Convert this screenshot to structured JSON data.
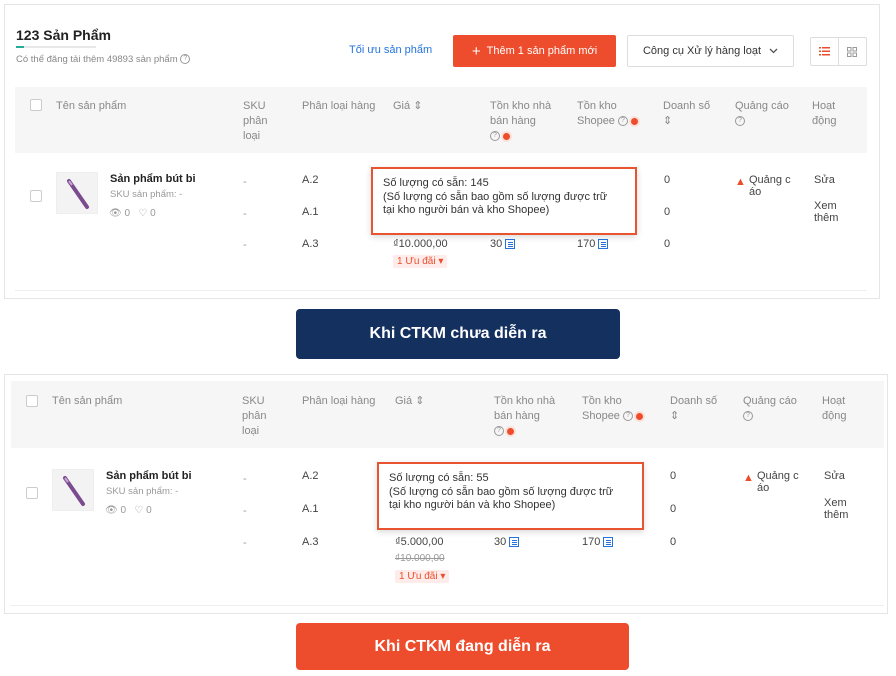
{
  "top": {
    "title": "123 Sản Phẩm",
    "subtitle": "Có thể đăng tải thêm 49893 sản phẩm",
    "optimize_link": "Tối ưu sản phẩm",
    "add_button": "Thêm 1 sản phẩm mới",
    "bulk_button": "Công cụ Xử lý hàng loạt"
  },
  "columns": {
    "name": "Tên sản phẩm",
    "sku_l1": "SKU",
    "sku_l2": "phân",
    "sku_l3": "loại",
    "variant": "Phân loại hàng",
    "price": "Giá",
    "seller_stock_l1": "Tồn kho nhà",
    "seller_stock_l2": "bán hàng",
    "shopee_stock_l1": "Tồn kho",
    "shopee_stock_l2": "Shopee",
    "sales": "Doanh số",
    "ads": "Quảng cáo",
    "action_l1": "Hoạt",
    "action_l2": "động"
  },
  "product": {
    "name": "Sản phẩm bút bi",
    "sku": "SKU sản phẩm: -",
    "views": "0",
    "likes": "0",
    "dash": "-",
    "variants": [
      "A.2",
      "A.1",
      "A.3"
    ],
    "sales": [
      "0",
      "0",
      "0"
    ],
    "seller_stock": "30",
    "shopee_stock": "170",
    "ads_l1": "Quảng c",
    "ads_l2": "áo",
    "edit": "Sửa",
    "more_l1": "Xem",
    "more_l2": "thêm",
    "promo": "1 Ưu đãi"
  },
  "before": {
    "price": "₫10.000,00",
    "tooltip_l1": "Số lượng có sẵn: 145",
    "tooltip_l2": "(Số lượng có sẵn bao gồm số lượng được trữ",
    "tooltip_l3": "tại kho người bán và kho Shopee)",
    "banner": "Khi CTKM chưa diễn ra"
  },
  "after": {
    "price": "₫5.000,00",
    "old_price": "₫10.000,00",
    "tooltip_l1": "Số lượng có sẵn: 55",
    "tooltip_l2": "(Số lượng có sẵn bao gồm số lượng được trữ",
    "tooltip_l3": "tại kho người bán và kho Shopee)",
    "banner": "Khi CTKM đang diễn ra"
  },
  "colors": {
    "accent": "#ee4d2d",
    "navy": "#13305f",
    "link": "#2673dd",
    "tooltip_border": "#e8542f"
  }
}
